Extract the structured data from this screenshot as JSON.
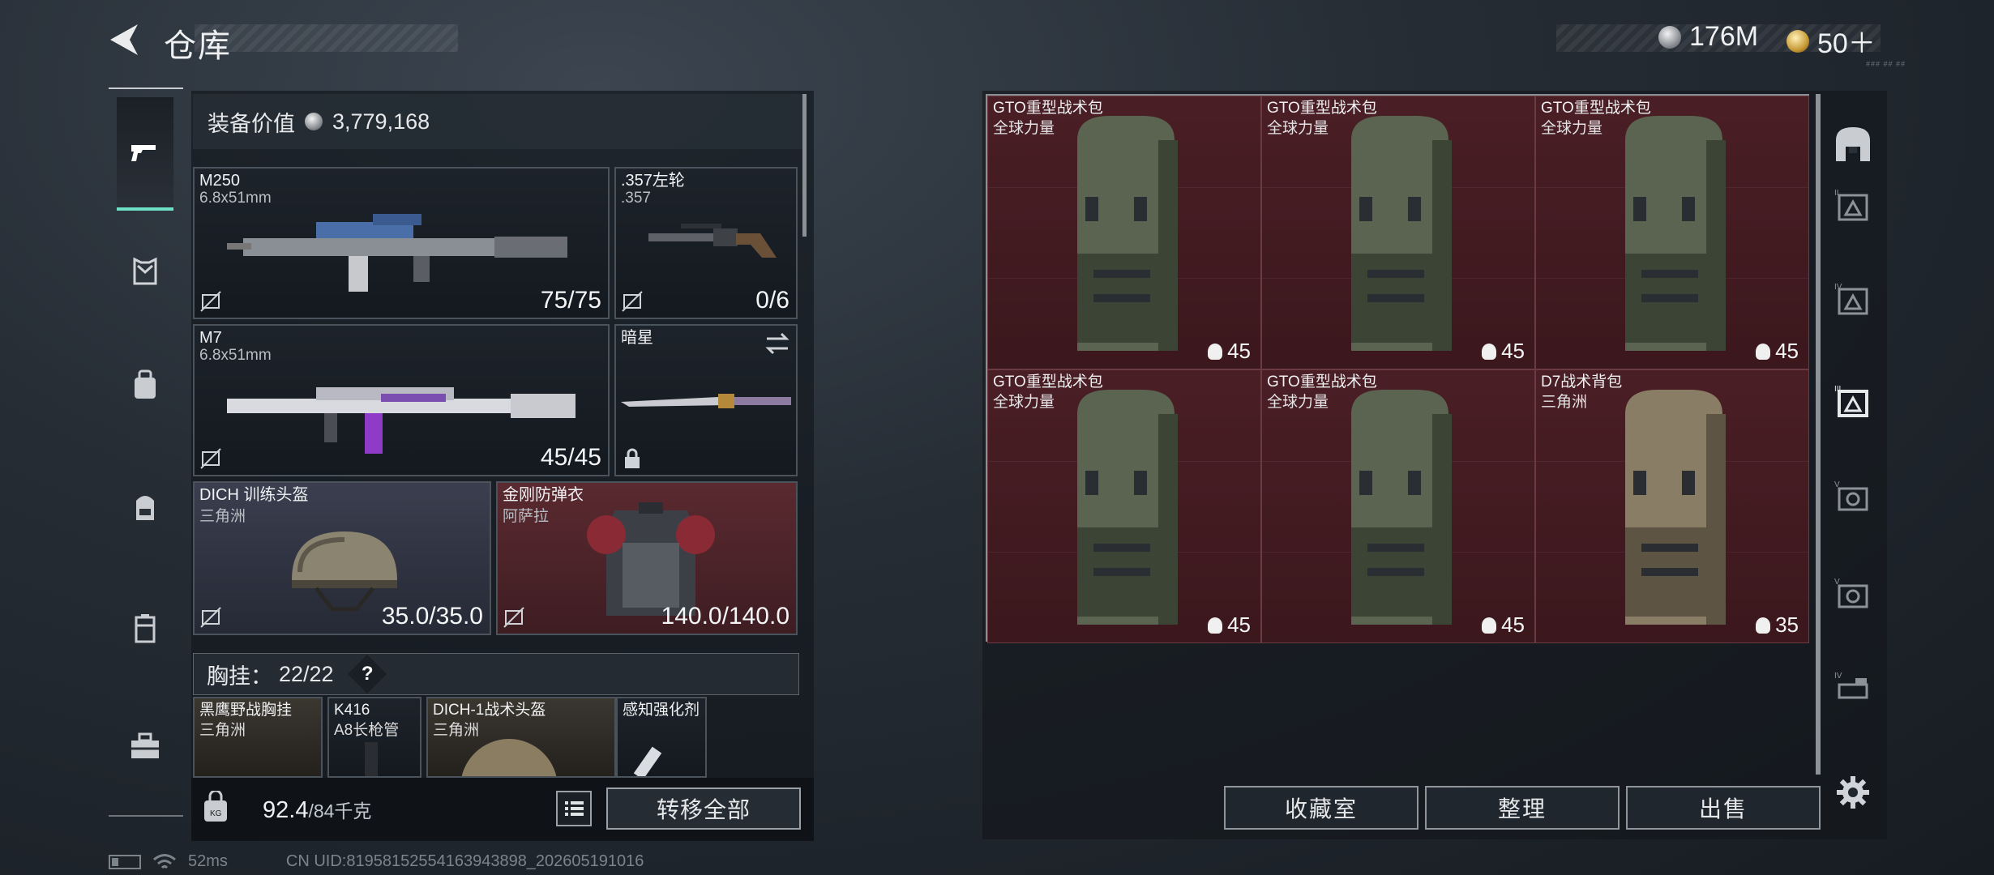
{
  "header": {
    "title": "仓库",
    "currency1": "176M",
    "currency2": "50＋",
    "version": "### ## ##"
  },
  "equipment": {
    "value_label": "装备价值",
    "value": "3,779,168"
  },
  "slots": {
    "primary": {
      "name": "M250",
      "ammo": "6.8x51mm",
      "count": "75/75"
    },
    "sidearm": {
      "name": ".357左轮",
      "ammo": ".357",
      "count": "0/6"
    },
    "secondary": {
      "name": "M7",
      "ammo": "6.8x51mm",
      "count": "45/45"
    },
    "melee": {
      "name": "暗星"
    },
    "helmet": {
      "name": "DICH 训练头盔",
      "faction": "三角洲",
      "count": "35.0/35.0"
    },
    "armor": {
      "name": "金刚防弹衣",
      "faction": "阿萨拉",
      "count": "140.0/140.0"
    }
  },
  "chest_rig": {
    "label": "胸挂：",
    "count": "22/22",
    "help": "?"
  },
  "chest_items": [
    {
      "name": "黑鹰野战胸挂",
      "sub": "三角洲"
    },
    {
      "name": "K416",
      "sub": "A8长枪管"
    },
    {
      "name": "DICH-1战术头盔",
      "sub": "三角洲"
    },
    {
      "name": "感知强化剂",
      "sub": ""
    }
  ],
  "footer": {
    "weight": "92.4",
    "weight_max": "/84千克",
    "transfer_all": "转移全部"
  },
  "storage_items": [
    {
      "name": "GTO重型战术包",
      "faction": "全球力量",
      "capacity": "45"
    },
    {
      "name": "GTO重型战术包",
      "faction": "全球力量",
      "capacity": "45"
    },
    {
      "name": "GTO重型战术包",
      "faction": "全球力量",
      "capacity": "45"
    },
    {
      "name": "GTO重型战术包",
      "faction": "全球力量",
      "capacity": "45"
    },
    {
      "name": "GTO重型战术包",
      "faction": "全球力量",
      "capacity": "45"
    },
    {
      "name": "D7战术背包",
      "faction": "三角洲",
      "capacity": "35"
    }
  ],
  "right_buttons": {
    "collection": "收藏室",
    "organize": "整理",
    "sell": "出售"
  },
  "status": {
    "ping": "52ms",
    "uid": "CN UID:8195815255416394389​8_202605191016"
  },
  "colors": {
    "accent": "#6ee0c8",
    "red_slot": "#4a1e25",
    "blue_slot": "#3a3e4e"
  }
}
